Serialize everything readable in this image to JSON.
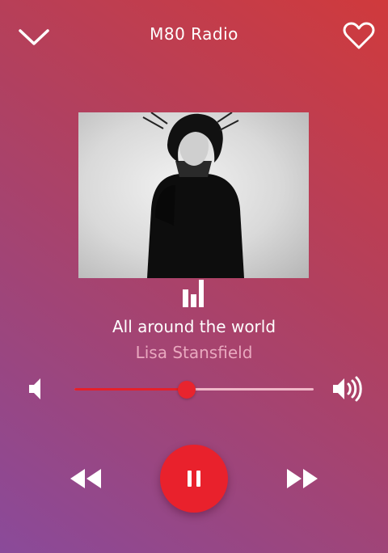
{
  "header": {
    "title": "M80 Radio",
    "collapse_icon": "chevron-down-icon",
    "favorite_icon": "heart-outline-icon"
  },
  "album_art": {
    "description_icon": "album-art-image"
  },
  "now_playing": {
    "song": "All around the world",
    "artist": "Lisa Stansfield",
    "indicator_icon": "equalizer-icon"
  },
  "volume": {
    "level": 0.47,
    "low_icon": "volume-low-icon",
    "high_icon": "volume-high-icon"
  },
  "controls": {
    "rewind_icon": "rewind-icon",
    "play_pause_icon": "pause-icon",
    "forward_icon": "fast-forward-icon"
  },
  "colors": {
    "accent": "#e9212c",
    "artist_text": "#e9a9bf",
    "track_bg": "#f0b7c8"
  }
}
